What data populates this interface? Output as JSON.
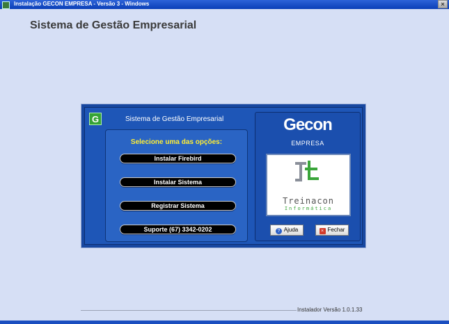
{
  "window": {
    "title": "Instalação GECON EMPRESA - Versão 3 - Windows",
    "close_label": "×"
  },
  "page_title": "Sistema de Gestão Empresarial",
  "panel": {
    "logo_letter": "G",
    "left_title": "Sistema de Gestão Empresarial",
    "options_title": "Selecione uma das opções:",
    "options": [
      {
        "label": "Instalar Firebird"
      },
      {
        "label": "Instalar Sistema"
      },
      {
        "label": "Registrar Sistema"
      },
      {
        "label": "Suporte (67) 3342-0202"
      }
    ],
    "brand": "Gecon",
    "brand_sub": "EMPRESA",
    "company_name": "Treinacon",
    "company_sub": "Informática",
    "help_label": "Ajuda",
    "close_label": "Fechar"
  },
  "footer": {
    "version": "Instalador Versão 1.0.1.33"
  },
  "colors": {
    "panel_blue": "#1e56b7",
    "options_title": "#ffee33",
    "logo_green": "#3aa53a",
    "logo_gray": "#8a8f99"
  }
}
